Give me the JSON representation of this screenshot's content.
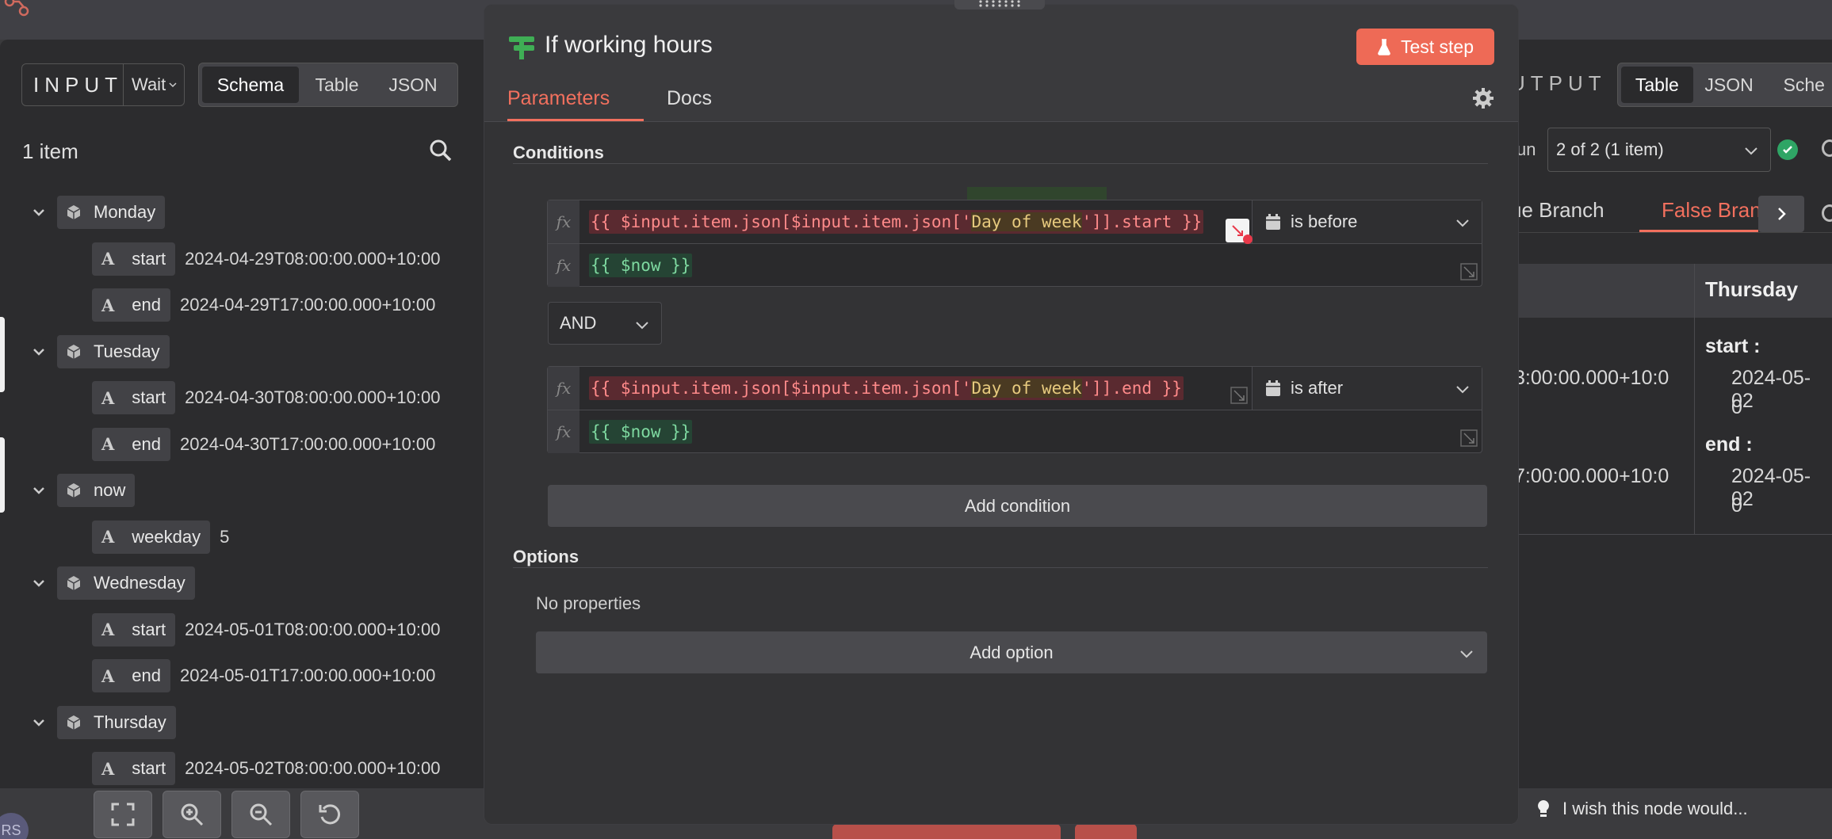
{
  "input_panel": {
    "label": "INPUT",
    "source_node": "Wait",
    "view_tabs": [
      "Schema",
      "Table",
      "JSON"
    ],
    "active_view": "Schema",
    "item_count": "1 item",
    "tree": [
      {
        "name": "Monday",
        "fields": [
          {
            "key": "start",
            "value": "2024-04-29T08:00:00.000+10:00"
          },
          {
            "key": "end",
            "value": "2024-04-29T17:00:00.000+10:00"
          }
        ]
      },
      {
        "name": "Tuesday",
        "fields": [
          {
            "key": "start",
            "value": "2024-04-30T08:00:00.000+10:00"
          },
          {
            "key": "end",
            "value": "2024-04-30T17:00:00.000+10:00"
          }
        ]
      },
      {
        "name": "now",
        "fields": [
          {
            "key": "weekday",
            "value": "5"
          }
        ]
      },
      {
        "name": "Wednesday",
        "fields": [
          {
            "key": "start",
            "value": "2024-05-01T08:00:00.000+10:00"
          },
          {
            "key": "end",
            "value": "2024-05-01T17:00:00.000+10:00"
          }
        ]
      },
      {
        "name": "Thursday",
        "fields": [
          {
            "key": "start",
            "value": "2024-05-02T08:00:00.000+10:00"
          }
        ]
      }
    ]
  },
  "node": {
    "title": "If working hours",
    "test_button": "Test step",
    "tabs": [
      "Parameters",
      "Docs"
    ],
    "active_tab": "Parameters",
    "conditions_label": "Conditions",
    "conditions": [
      {
        "left": {
          "prefix": "{{ $input.item.json[$input.item.json['",
          "str": "Day of week",
          "suffix": "']].start }}"
        },
        "operator": "is before",
        "right": "{{ $now }}"
      },
      {
        "left": {
          "prefix": "{{ $input.item.json[$input.item.json['",
          "str": "Day of week",
          "suffix": "']].end }}"
        },
        "operator": "is after",
        "right": "{{ $now }}"
      }
    ],
    "combinator": "AND",
    "add_condition": "Add condition",
    "options_label": "Options",
    "no_properties": "No properties",
    "add_option": "Add option",
    "fx_label": "fx"
  },
  "output_panel": {
    "label": "UTPUT",
    "view_tabs": [
      "Table",
      "JSON",
      "Sche"
    ],
    "active_view": "Table",
    "run_label": "un",
    "run_select": "2 of 2 (1 item)",
    "branches": [
      "ue Branch",
      "False Bran"
    ],
    "active_branch": "False Bran",
    "table": {
      "column_header": "Thursday",
      "left_cells": [
        "3:00:00.000+10:0",
        "7:00:00.000+10:0"
      ],
      "start_key": "start :",
      "start_value_1": "2024-05-02",
      "start_value_2": "0",
      "end_key": "end :",
      "end_value_1": "2024-05-02",
      "end_value_2": "0"
    }
  },
  "footer": {
    "feedback": "I wish this node would...",
    "avatar_initials": "RS"
  },
  "colors": {
    "accent": "#ee6a56",
    "accent_text": "#f2705e",
    "success": "#2fa565",
    "panel_bg": "#2c2c2e",
    "modal_bg": "#333335"
  }
}
